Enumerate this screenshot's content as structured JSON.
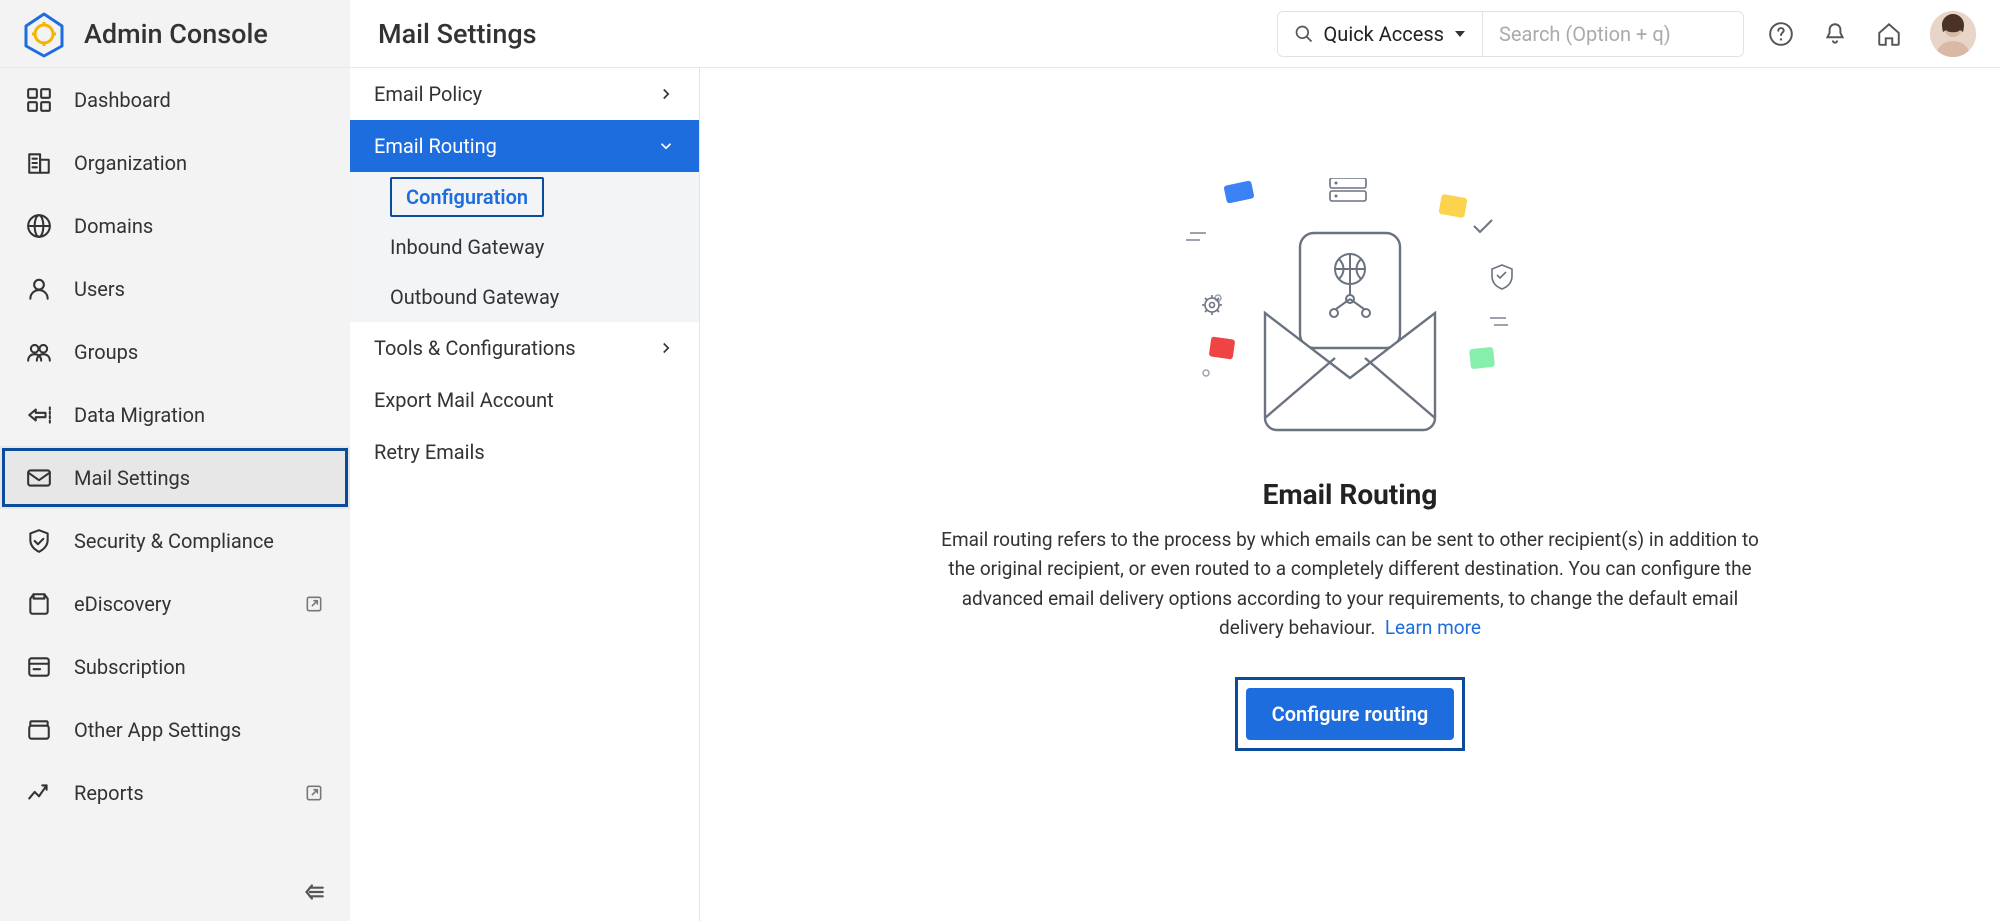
{
  "app_title": "Admin Console",
  "page_title": "Mail Settings",
  "quick_access_label": "Quick Access",
  "search_placeholder": "Search (Option + q)",
  "sidebar": [
    {
      "icon": "dashboard",
      "label": "Dashboard"
    },
    {
      "icon": "org",
      "label": "Organization"
    },
    {
      "icon": "globe",
      "label": "Domains"
    },
    {
      "icon": "user",
      "label": "Users"
    },
    {
      "icon": "groups",
      "label": "Groups"
    },
    {
      "icon": "migration",
      "label": "Data Migration"
    },
    {
      "icon": "mail",
      "label": "Mail Settings",
      "active": true,
      "highlight": true
    },
    {
      "icon": "shield",
      "label": "Security & Compliance"
    },
    {
      "icon": "ediscovery",
      "label": "eDiscovery",
      "ext": true
    },
    {
      "icon": "subscription",
      "label": "Subscription"
    },
    {
      "icon": "apps",
      "label": "Other App Settings"
    },
    {
      "icon": "reports",
      "label": "Reports",
      "ext": true
    }
  ],
  "submenu": {
    "items": [
      {
        "label": "Email Policy",
        "expandable": true
      },
      {
        "label": "Email Routing",
        "expandable": true,
        "expanded": true,
        "blue": true,
        "children": [
          {
            "label": "Configuration",
            "selected": true
          },
          {
            "label": "Inbound Gateway"
          },
          {
            "label": "Outbound Gateway"
          }
        ]
      },
      {
        "label": "Tools & Configurations",
        "expandable": true
      },
      {
        "label": "Export Mail Account"
      },
      {
        "label": "Retry Emails"
      }
    ]
  },
  "main": {
    "heading": "Email Routing",
    "body": "Email routing refers to the process by which emails can be sent to other recipient(s) in addition to the original recipient, or even routed to a completely different destination. You can configure the advanced email delivery options according to your requirements, to change the default email delivery behaviour.",
    "learn_more": "Learn more",
    "cta": "Configure routing"
  },
  "colors": {
    "accent": "#1e6dde",
    "highlight": "#0b4b9b"
  }
}
